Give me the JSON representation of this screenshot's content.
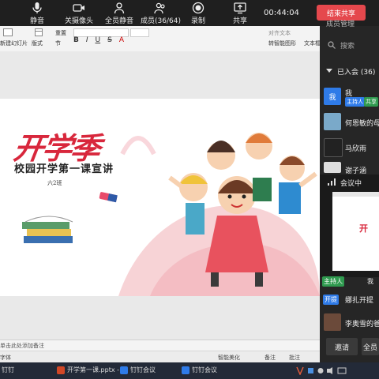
{
  "meeting_bar": {
    "buttons": [
      {
        "label": "静音",
        "icon": "microphone-icon"
      },
      {
        "label": "关摄像头",
        "icon": "camera-icon"
      },
      {
        "label": "全员静音",
        "icon": "mute-all-icon"
      },
      {
        "label": "成员(36/64)",
        "icon": "members-icon"
      },
      {
        "label": "录制",
        "icon": "record-icon"
      },
      {
        "label": "共享",
        "icon": "share-screen-icon"
      }
    ],
    "time": "00:44:04",
    "end_share": "结束共享"
  },
  "ribbon": {
    "new_slide": "新建幻灯片",
    "layout": "版式",
    "section": "节",
    "reset": "重置",
    "align_text": "对齐文本",
    "smartart": "转智能图形",
    "textbox": "文本框",
    "format_buttons": [
      "B",
      "I",
      "U",
      "S",
      "A"
    ]
  },
  "slide": {
    "art_title": "开学季",
    "title": "校园开学第一课宣讲",
    "subtitle": "六2班"
  },
  "notes_placeholder": "单击此处添加备注",
  "statusbar": {
    "left": "字体",
    "smart": "智能美化",
    "notes": "备注",
    "comment": "批注"
  },
  "panel": {
    "header": "成员管理",
    "search": "搜索",
    "joined": "已入会 (36)",
    "members": [
      {
        "name": "我",
        "tags": [
          "主持人",
          "共享"
        ]
      },
      {
        "name": "何恩敏的母"
      },
      {
        "name": "马欣雨"
      },
      {
        "name": "谢子涵"
      }
    ],
    "in_meeting": "会议中",
    "host_tag": "主持人",
    "me_label": "我",
    "rename_tag": "开提",
    "rename_name": "娜扎开提",
    "last_member": "李奥雪的爸",
    "invite": "邀请",
    "mute_all": "全员"
  },
  "taskbar": {
    "items": [
      "钉钉",
      "开学第一课.pptx - ...",
      "钉钉会议",
      "钉钉会议"
    ]
  }
}
